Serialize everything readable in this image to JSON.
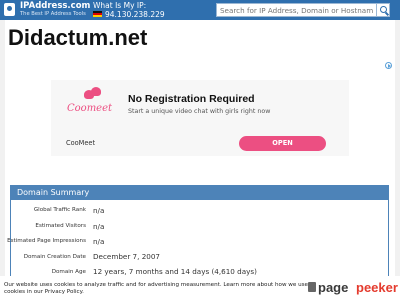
{
  "topbar": {
    "site_name": "IPAddress.com",
    "site_tagline": "The Best IP Address Tools",
    "myip_label": "What Is My IP:",
    "myip_value": "94.130.238.229",
    "search_placeholder": "Search for IP Address, Domain or Hostname"
  },
  "page_title": "Didactum.net",
  "ad": {
    "logo_text": "Coomeet",
    "headline": "No Registration Required",
    "description": "Start a unique video chat with girls right now",
    "advertiser": "CooMeet",
    "button_label": "OPEN",
    "accent_color": "#ec4f82"
  },
  "summary": {
    "title": "Domain Summary",
    "rows": [
      {
        "label": "Global Traffic Rank",
        "value": "n/a"
      },
      {
        "label": "Estimated Visitors",
        "value": "n/a"
      },
      {
        "label": "Estimated Page Impressions",
        "value": "n/a"
      },
      {
        "label": "Domain Creation Date",
        "value": "December 7, 2007"
      },
      {
        "label": "Domain Age",
        "value": "12 years, 7 months and 14 days (4,610 days)"
      }
    ]
  },
  "cookie_text": "Our website uses cookies to analyze traffic and for advertising measurement. Learn more about how we use cookies in our Privacy Policy.",
  "watermark": {
    "part1": "page",
    "part2": "peeker"
  },
  "colors": {
    "topbar": "#2f6fae",
    "panel_header": "#4d83b8"
  }
}
